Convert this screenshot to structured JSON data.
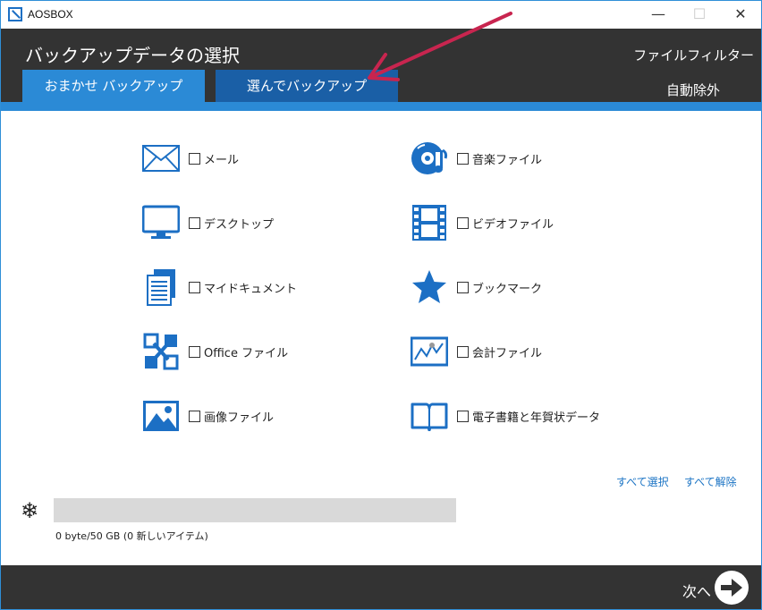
{
  "window": {
    "title": "AOSBOX",
    "controls": {
      "minimize": "—",
      "maximize": "☐",
      "close": "✕"
    }
  },
  "header": {
    "title": "バックアップデータの選択",
    "tabs": [
      {
        "label": "おまかせ バックアップ",
        "active": true
      },
      {
        "label": "選んでバックアップ",
        "active": false
      }
    ],
    "file_filter": "ファイルフィルター",
    "auto_exclude": "自動除外"
  },
  "categories": {
    "left": [
      {
        "label": "メール",
        "icon": "mail-icon",
        "checked": false
      },
      {
        "label": "デスクトップ",
        "icon": "monitor-icon",
        "checked": false
      },
      {
        "label": "マイドキュメント",
        "icon": "documents-icon",
        "checked": false
      },
      {
        "label": "Office ファイル",
        "icon": "office-icon",
        "checked": false
      },
      {
        "label": "画像ファイル",
        "icon": "image-icon",
        "checked": false
      }
    ],
    "right": [
      {
        "label": "音楽ファイル",
        "icon": "music-icon",
        "checked": false
      },
      {
        "label": "ビデオファイル",
        "icon": "film-icon",
        "checked": false
      },
      {
        "label": "ブックマーク",
        "icon": "star-icon",
        "checked": false
      },
      {
        "label": "会計ファイル",
        "icon": "chart-icon",
        "checked": false
      },
      {
        "label": "電子書籍と年賀状データ",
        "icon": "book-icon",
        "checked": false
      }
    ]
  },
  "select_all": "すべて選択",
  "deselect_all": "すべて解除",
  "storage": {
    "text": "0 byte/50 GB (0 新しいアイテム)",
    "used_fraction": 0
  },
  "footer": {
    "next_label": "次へ"
  },
  "colors": {
    "accent": "#2b8ad6",
    "tab_dark": "#1a5fa6",
    "header_bg": "#333333",
    "icon_blue": "#1c6fc4",
    "annotation": "#c8254f"
  }
}
